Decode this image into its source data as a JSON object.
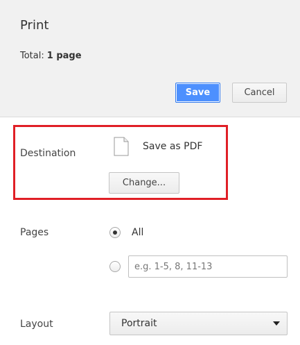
{
  "header": {
    "title": "Print",
    "total_label": "Total:",
    "total_value": "1 page",
    "save_label": "Save",
    "cancel_label": "Cancel"
  },
  "destination": {
    "label": "Destination",
    "icon": "document-icon",
    "name": "Save as PDF",
    "change_label": "Change...",
    "highlight_color": "#e01f26"
  },
  "pages": {
    "label": "Pages",
    "option_all": "All",
    "custom_placeholder": "e.g. 1-5, 8, 11-13",
    "custom_value": ""
  },
  "layout": {
    "label": "Layout",
    "selected": "Portrait"
  },
  "colors": {
    "accent": "#4d90fe",
    "header_bg": "#f1f1f1"
  }
}
